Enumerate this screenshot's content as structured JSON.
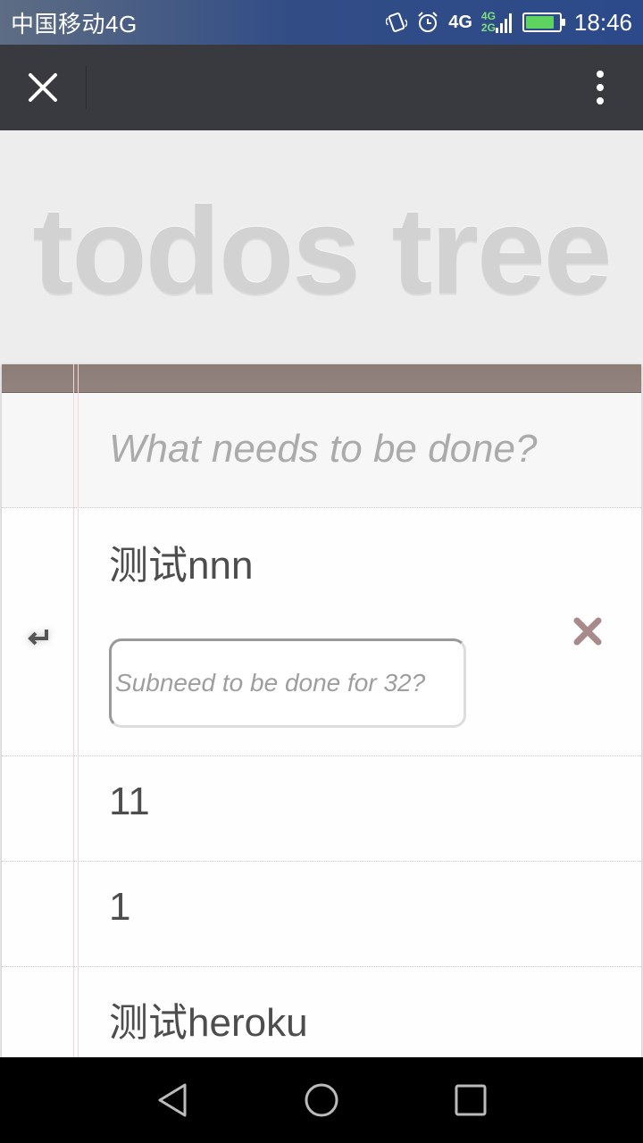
{
  "status_bar": {
    "carrier": "中国移动4G",
    "network_primary": "4G",
    "network_secondary_top": "4G",
    "network_secondary_bottom": "2G",
    "battery_level": 0.85,
    "time": "18:46",
    "icons": [
      "vibrate-icon",
      "alarm-icon",
      "signal-icon",
      "battery-icon"
    ]
  },
  "toolbar": {
    "close_icon": "close-icon",
    "more_icon": "more-vertical-icon"
  },
  "header": {
    "title": "todos tree"
  },
  "new_todo": {
    "placeholder": "What needs to be done?"
  },
  "todos": [
    {
      "label": "测试nnn",
      "expanded": true,
      "subtodo_placeholder": "Subneed to be done for 32?",
      "enter_icon": "enter-icon",
      "destroy_icon": "delete-icon"
    },
    {
      "label": "11"
    },
    {
      "label": "1"
    },
    {
      "label": "测试heroku"
    }
  ],
  "colors": {
    "topbar": "#8d7d77",
    "destroy": "#a88a8a",
    "title": "#d2d2d2",
    "text": "#4d4d4d"
  },
  "nav_bar": {
    "buttons": [
      "back-icon",
      "home-icon",
      "recents-icon"
    ]
  }
}
